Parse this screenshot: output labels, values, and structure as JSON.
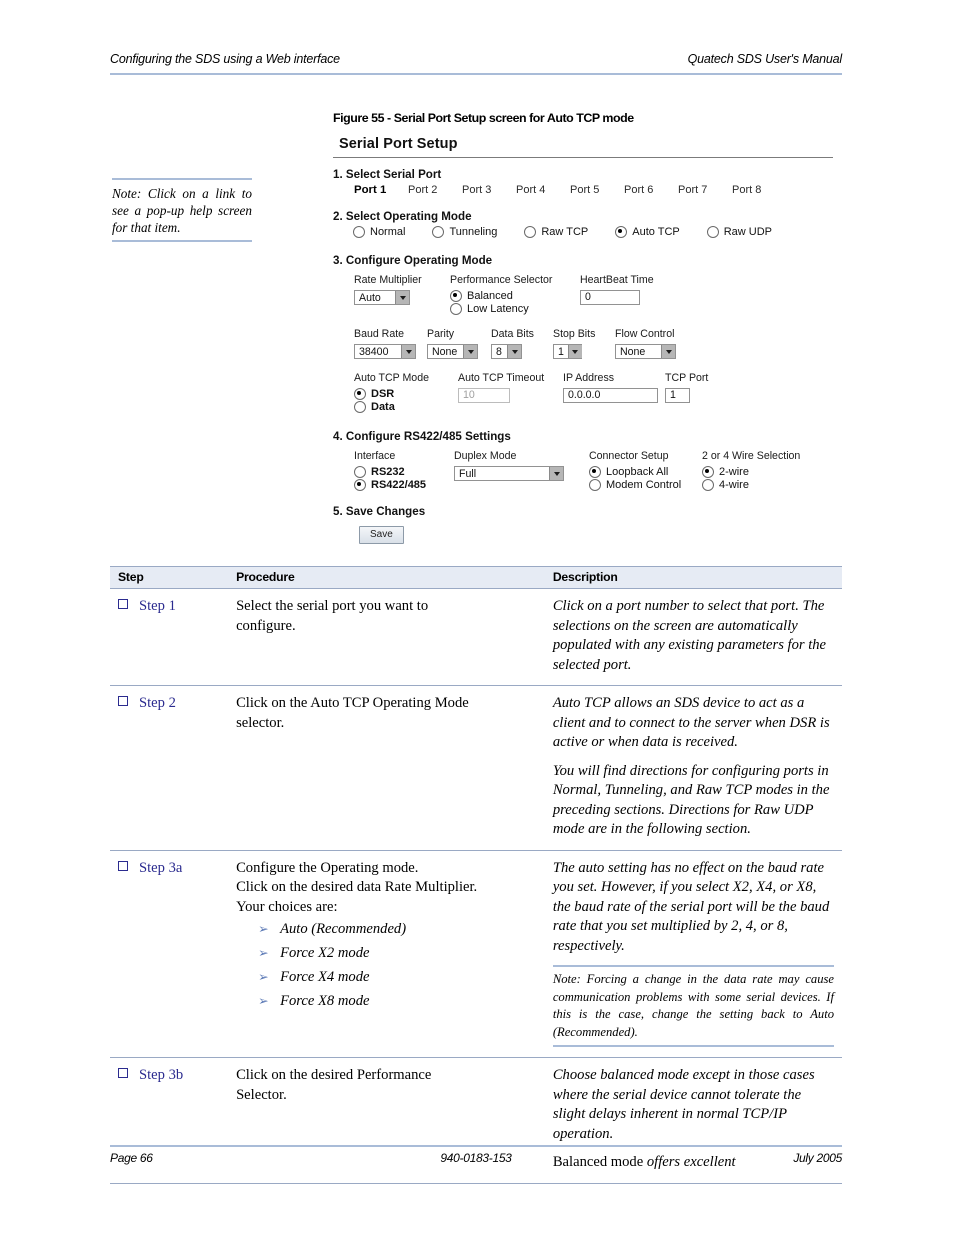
{
  "header": {
    "left": "Configuring the SDS using a Web interface",
    "right": "Quatech SDS User's Manual"
  },
  "figure": {
    "caption": "Figure 55 - Serial Port Setup screen for Auto TCP mode"
  },
  "margin_note": {
    "text": "Note: Click on a link to see a pop-up help screen for that item."
  },
  "form": {
    "title": "Serial Port Setup",
    "section1": {
      "heading": "1. Select Serial Port",
      "ports": [
        "Port 1",
        "Port 2",
        "Port 3",
        "Port 4",
        "Port 5",
        "Port 6",
        "Port 7",
        "Port 8"
      ],
      "selected_port": "Port 1"
    },
    "section2": {
      "heading": "2. Select Operating Mode",
      "modes": [
        "Normal",
        "Tunneling",
        "Raw TCP",
        "Auto TCP",
        "Raw UDP"
      ],
      "selected_mode": "Auto TCP"
    },
    "section3": {
      "heading": "3. Configure Operating Mode",
      "rate_multiplier": {
        "label": "Rate Multiplier",
        "value": "Auto"
      },
      "performance_selector": {
        "label": "Performance Selector",
        "options": [
          "Balanced",
          "Low Latency"
        ],
        "selected": "Balanced"
      },
      "heartbeat_time": {
        "label": "HeartBeat Time",
        "value": "0"
      },
      "baud_rate": {
        "label": "Baud Rate",
        "value": "38400"
      },
      "parity": {
        "label": "Parity",
        "value": "None"
      },
      "data_bits": {
        "label": "Data Bits",
        "value": "8"
      },
      "stop_bits": {
        "label": "Stop Bits",
        "value": "1"
      },
      "flow_control": {
        "label": "Flow Control",
        "value": "None"
      },
      "auto_tcp_mode": {
        "label": "Auto TCP Mode",
        "options": [
          "DSR",
          "Data"
        ],
        "selected": "DSR"
      },
      "auto_tcp_timeout": {
        "label": "Auto TCP Timeout",
        "value": "10",
        "disabled": true
      },
      "ip_address": {
        "label": "IP Address",
        "value": "0.0.0.0"
      },
      "tcp_port": {
        "label": "TCP Port",
        "value": "1"
      }
    },
    "section4": {
      "heading": "4. Configure RS422/485 Settings",
      "interface": {
        "label": "Interface",
        "options": [
          "RS232",
          "RS422/485"
        ],
        "selected": "RS422/485"
      },
      "duplex_mode": {
        "label": "Duplex Mode",
        "value": "Full"
      },
      "connector_setup": {
        "label": "Connector Setup",
        "options": [
          "Loopback All",
          "Modem Control"
        ],
        "selected": "Loopback All"
      },
      "wire_selection": {
        "label": "2 or 4 Wire Selection",
        "options": [
          "2-wire",
          "4-wire"
        ],
        "selected": "2-wire"
      }
    },
    "section5": {
      "heading": "5. Save Changes",
      "save_label": "Save"
    }
  },
  "table": {
    "columns": [
      "Step",
      "Procedure",
      "Description"
    ],
    "rows": [
      {
        "step": "Step 1",
        "procedure_lines": [
          "Select the serial port you want to",
          "configure."
        ],
        "description_paragraphs": [
          "Click on a port number to select that port. The selections on the screen are automatically populated with any existing parameters for the selected port."
        ]
      },
      {
        "step": "Step 2",
        "procedure_lines": [
          "Click on the Auto TCP Operating Mode",
          "selector."
        ],
        "description_paragraphs": [
          "Auto TCP allows an SDS device to act as a client and to connect to the server when DSR is active or when data is received.",
          "You will find directions for configuring ports in Normal, Tunneling, and Raw TCP modes in the preceding sections. Directions for Raw UDP mode are in the following section."
        ]
      },
      {
        "step": "Step 3a",
        "procedure_lines": [
          "Configure the Operating mode.",
          "Click on the desired data Rate Multiplier.",
          "Your choices are:"
        ],
        "procedure_bullets": [
          "Auto (Recommended)",
          "Force X2 mode",
          "Force X4 mode",
          "Force X8 mode"
        ],
        "description_paragraphs": [
          "The auto setting has no effect on the baud rate you set. However, if you select X2, X4, or X8, the baud rate of the serial port will be the baud rate that you set multiplied by 2, 4, or 8, respectively."
        ],
        "description_note": "Note: Forcing a change in the data rate may cause communication problems with some serial devices. If this is the case, change the setting back to Auto (Recommended)."
      },
      {
        "step": "Step 3b",
        "procedure_lines": [
          "Click on the desired Performance",
          "Selector."
        ],
        "description_paragraphs": [
          "Choose balanced mode except in those cases where the serial device cannot tolerate the slight delays inherent in normal TCP/IP operation."
        ],
        "description_mixed": {
          "plain": "Balanced mode ",
          "italic": "offers excellent"
        }
      }
    ]
  },
  "footer": {
    "left": "Page 66",
    "center": "940-0183-153",
    "right": "July 2005"
  }
}
